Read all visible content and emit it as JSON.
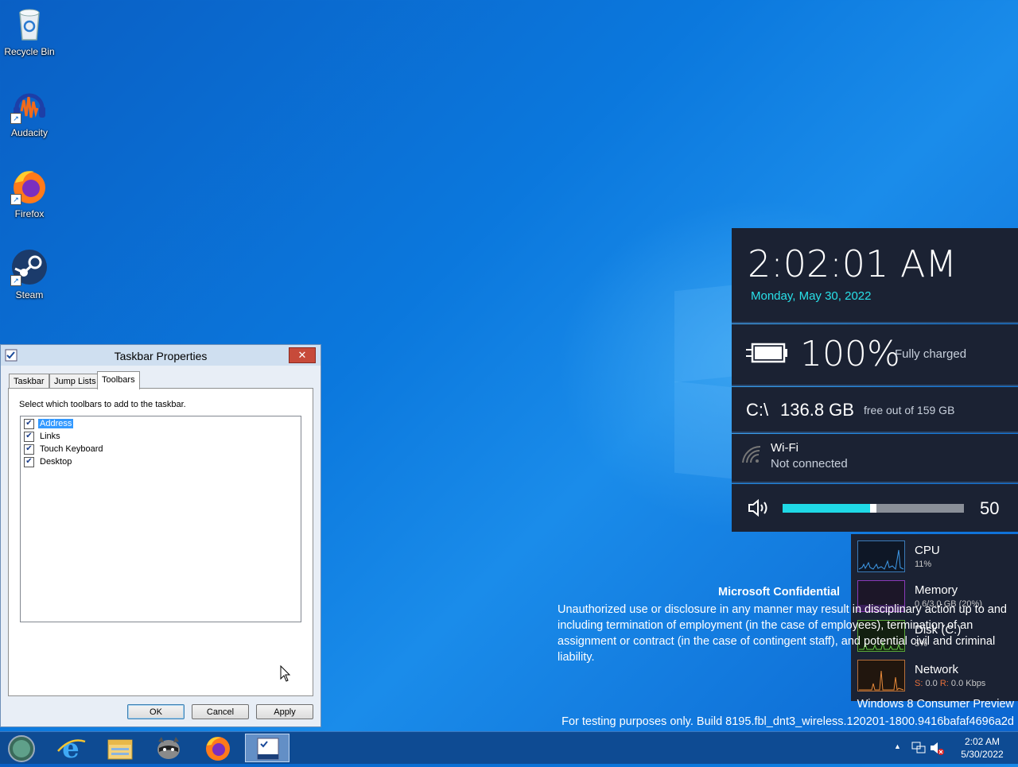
{
  "desktop": {
    "icons": [
      {
        "label": "Recycle Bin",
        "icon": "recycle-bin-icon"
      },
      {
        "label": "Audacity",
        "icon": "audacity-icon"
      },
      {
        "label": "Firefox",
        "icon": "firefox-icon"
      },
      {
        "label": "Steam",
        "icon": "steam-icon"
      }
    ]
  },
  "gadgets": {
    "clock": {
      "time": "2:02:01 AM",
      "date": "Monday, May 30, 2022"
    },
    "battery": {
      "percent": "100%",
      "status": "Fully charged",
      "icon": "battery-charging-icon"
    },
    "disk": {
      "drive": "C:\\",
      "free": "136.8 GB",
      "total_text": "free out of 159 GB"
    },
    "wifi": {
      "name": "Wi-Fi",
      "status": "Not connected",
      "icon": "wifi-icon"
    },
    "volume": {
      "level_text": "50",
      "level": 0.5,
      "icon": "speaker-icon"
    },
    "taskmanager": {
      "cpu": {
        "title": "CPU",
        "value": "11%"
      },
      "memory": {
        "title": "Memory",
        "value": "0.6/3.0 GB (20%)"
      },
      "disk": {
        "title": "Disk (C:)",
        "value": "5%"
      },
      "network": {
        "title": "Network",
        "s_label": "S:",
        "s_value": "0.0",
        "r_label": "R:",
        "r_value": "0.0 Kbps"
      }
    },
    "colors": {
      "accent": "#29e0e8",
      "panel": "#1b2233"
    }
  },
  "dialog": {
    "title": "Taskbar Properties",
    "close_label": "✕",
    "tabs": [
      "Taskbar",
      "Jump Lists",
      "Toolbars"
    ],
    "active_tab": "Toolbars",
    "instruction": "Select which toolbars to add to the taskbar.",
    "toolbars": [
      {
        "label": "Address",
        "checked": true,
        "selected": true
      },
      {
        "label": "Links",
        "checked": true,
        "selected": false
      },
      {
        "label": "Touch Keyboard",
        "checked": true,
        "selected": false
      },
      {
        "label": "Desktop",
        "checked": true,
        "selected": false
      }
    ],
    "buttons": {
      "ok": "OK",
      "cancel": "Cancel",
      "apply": "Apply"
    }
  },
  "confidential": {
    "title": "Microsoft Confidential",
    "body": "Unauthorized use or disclosure in any manner may result in disciplinary action up to and including termination of employment (in the case of employees), termination of an assignment or contract (in the case of contingent staff), and potential civil and criminal liability."
  },
  "watermark": {
    "line1": "Windows 8 Consumer Preview",
    "line2": "For testing purposes only. Build 8195.fbl_dnt3_wireless.120201-1800.9416bafaf4696a2d"
  },
  "taskbar": {
    "items": [
      "start-orb-icon",
      "internet-explorer-icon",
      "file-explorer-icon",
      "raccoon-app-icon",
      "firefox-icon",
      "taskbar-properties-icon"
    ],
    "tray": {
      "time": "2:02 AM",
      "date": "5/30/2022",
      "chevron": "▲"
    }
  }
}
